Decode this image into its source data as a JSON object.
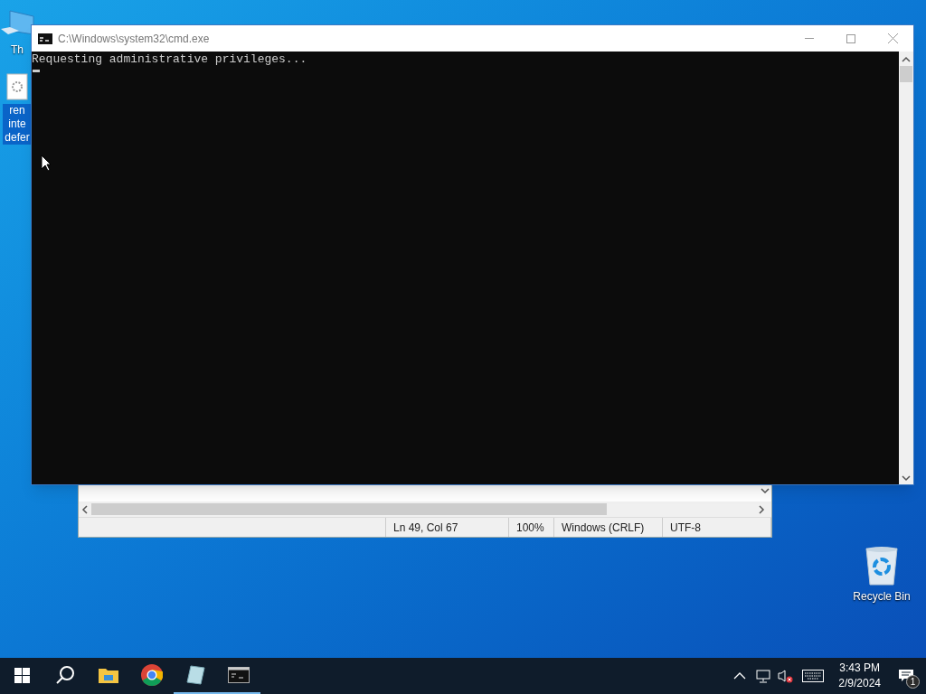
{
  "desktop_icons": [
    {
      "kind": "computer",
      "label_lines": [
        "Th"
      ],
      "selected": false
    },
    {
      "kind": "settings-file",
      "label_lines": [
        "ren",
        "inte",
        "defer"
      ],
      "selected": true
    },
    {
      "kind": "recycle-bin",
      "label_lines": [
        "Recycle Bin"
      ],
      "selected": false
    }
  ],
  "notepad": {
    "status": [
      "Ln 49, Col 67",
      "100%",
      "Windows (CRLF)",
      "UTF-8"
    ]
  },
  "cmd": {
    "title": "C:\\Windows\\system32\\cmd.exe",
    "lines": [
      "Requesting administrative privileges..."
    ],
    "cursor_visible": true
  },
  "taskbar": {
    "items": [
      {
        "kind": "start",
        "running": false
      },
      {
        "kind": "search",
        "running": false
      },
      {
        "kind": "explorer",
        "running": false
      },
      {
        "kind": "chrome",
        "running": false
      },
      {
        "kind": "notepad",
        "running": true
      },
      {
        "kind": "cmd",
        "running": true
      }
    ],
    "clock": {
      "time": "3:43 PM",
      "date": "2/9/2024"
    },
    "sound_muted": true,
    "notification_count": "1"
  }
}
